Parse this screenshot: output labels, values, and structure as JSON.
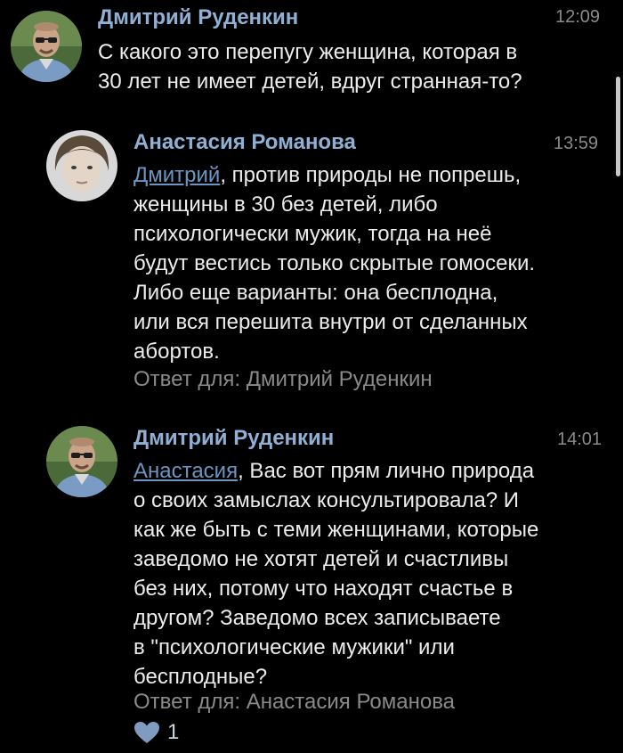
{
  "comments": [
    {
      "author": "Дмитрий Руденкин",
      "time": "12:09",
      "lines": [
        "С какого это перепугу женщина, которая в",
        "30 лет не имеет детей, вдруг странная-то?"
      ]
    },
    {
      "author": "Анастасия Романова",
      "time": "13:59",
      "mention": "Дмитрий",
      "lines": [
        ", против природы не попрешь,",
        "женщины в 30 без детей, либо",
        "психологически мужик, тогда на неё",
        "будут вестись только скрытые гомосеки.",
        "Либо еще варианты: она бесплодна,",
        "или вся перешита внутри от сделанных",
        "абортов."
      ],
      "reply": "Ответ для: Дмитрий Руденкин"
    },
    {
      "author": "Дмитрий Руденкин",
      "time": "14:01",
      "mention": "Анастасия",
      "lines": [
        ", Вас вот прям лично природа",
        "о своих замыслах консультировала? И",
        "как же быть с теми женщинами, которые",
        "заведомо не хотят детей и счастливы",
        "без них, потому что находят счастье в",
        "другом? Заведомо всех записываете",
        "в \"психологические мужики\" или",
        "бесплодные?"
      ],
      "reply": "Ответ для: Анастасия Романова",
      "likes": "1"
    }
  ],
  "colors": {
    "background": "#000000",
    "author": "#8fb0d4",
    "mention": "#6c95c2",
    "muted": "#8a8a8a",
    "like": "#7f9cc0"
  }
}
